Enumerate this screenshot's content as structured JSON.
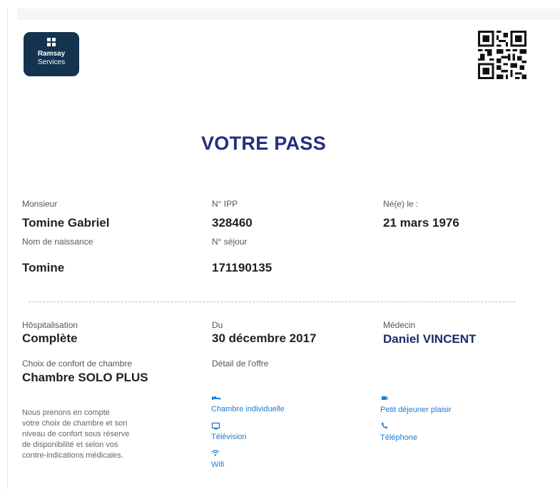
{
  "logo": {
    "line1": "Ramsay",
    "line2": "Services"
  },
  "title": "VOTRE PASS",
  "patient": {
    "civility_label": "Monsieur",
    "name": "Tomine Gabriel",
    "ipp_label": "N° IPP",
    "ipp": "328460",
    "birth_label": "Né(e) le :",
    "birth_date": "21 mars 1976",
    "birth_name_label": "Nom de naissance",
    "birth_name": "Tomine",
    "stay_label": "N° séjour",
    "stay_number": "171190135"
  },
  "stay": {
    "hosp_label": "Hôspitalisation",
    "hosp_value": "Complète",
    "from_label": "Du",
    "from_date": "30 décembre 2017",
    "doctor_label": "Médecin",
    "doctor": "Daniel VINCENT",
    "comfort_label": "Choix de confort de chambre",
    "comfort_value": "Chambre SOLO PLUS",
    "offer_label": "Détail de l'offre",
    "note": "Nous prenons en compte\nvotre choix de chambre et son\nniveau de confort sous réserve\nde disponibilité et selon vos\ncontre-indications médicales."
  },
  "features": [
    {
      "icon": "bed-icon",
      "label": "Chambre individuelle"
    },
    {
      "icon": "coffee-icon",
      "label": "Petit déjeuner plaisir"
    },
    {
      "icon": "tv-icon",
      "label": "Télévision"
    },
    {
      "icon": "phone-icon",
      "label": "Téléphone"
    },
    {
      "icon": "wifi-icon",
      "label": "Wifi"
    }
  ],
  "colors": {
    "title": "#252f7c",
    "logo_bg": "#13334f",
    "feature": "#1e7ad1"
  }
}
